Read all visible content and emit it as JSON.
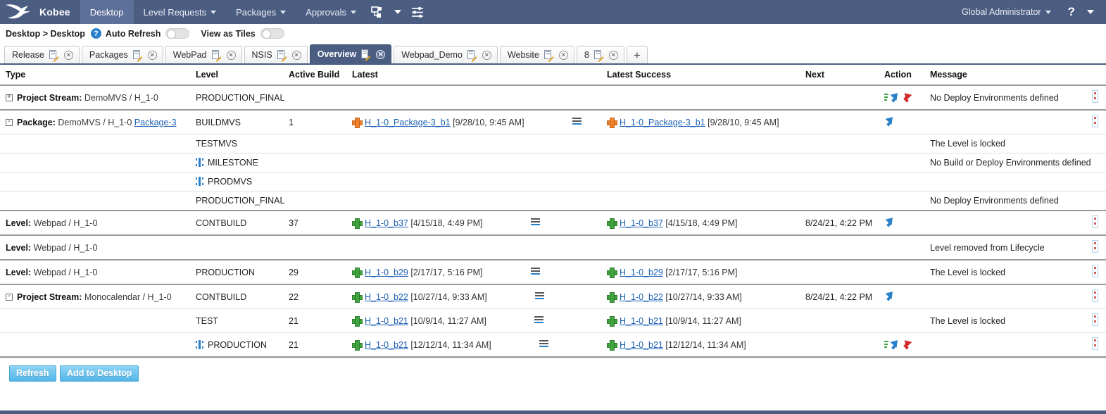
{
  "topnav": {
    "brand": "Kobee",
    "items": [
      {
        "label": "Desktop",
        "active": true,
        "caret": false
      },
      {
        "label": "Level Requests",
        "active": false,
        "caret": true
      },
      {
        "label": "Packages",
        "active": false,
        "caret": true
      },
      {
        "label": "Approvals",
        "active": false,
        "caret": true
      }
    ],
    "icons": [
      "workflow-icon",
      "chevron-down-icon",
      "sliders-icon"
    ],
    "user": "Global Administrator",
    "help": "?"
  },
  "crumb": {
    "text": "Desktop > Desktop",
    "help_label": "?",
    "auto_refresh_label": "Auto Refresh",
    "auto_refresh_on": false,
    "view_tiles_label": "View as Tiles",
    "view_tiles_on": false
  },
  "tabs": {
    "items": [
      {
        "label": "Release",
        "active": false
      },
      {
        "label": "Packages",
        "active": false
      },
      {
        "label": "WebPad",
        "active": false
      },
      {
        "label": "NSIS",
        "active": false
      },
      {
        "label": "Overview",
        "active": true
      },
      {
        "label": "Webpad_Demo",
        "active": false
      },
      {
        "label": "Website",
        "active": false
      },
      {
        "label": "8",
        "active": false
      }
    ],
    "add_label": "+"
  },
  "table": {
    "headers": [
      "Type",
      "Level",
      "Active Build",
      "Latest",
      "Latest Success",
      "Next",
      "Action",
      "Message"
    ],
    "rows": [
      {
        "group_top": true,
        "group_end": true,
        "expander": "+",
        "type_label": "Project Stream:",
        "type_value": "DemoMVS / H_1-0",
        "level": "PRODUCTION_FINAL",
        "level_milestone": false,
        "active_build": "",
        "latest_build": "",
        "latest_stamp": "",
        "latest_plus": "",
        "latest_list": false,
        "success_build": "",
        "success_stamp": "",
        "success_plus": "",
        "next": "",
        "action": "promote-rollback",
        "message": "No Deploy Environments defined",
        "edge": true
      },
      {
        "group_top": true,
        "expander": "-",
        "type_label": "Package:",
        "type_value": "DemoMVS / H_1-0",
        "type_link": "Package-3",
        "level": "BUILDMVS",
        "level_milestone": false,
        "active_build": "1",
        "latest_build": "H_1-0_Package-3_b1",
        "latest_stamp": "[9/28/10, 9:45 AM]",
        "latest_plus": "orange",
        "latest_list": true,
        "success_build": "H_1-0_Package-3_b1",
        "success_stamp": "[9/28/10, 9:45 AM]",
        "success_plus": "orange",
        "next": "",
        "action": "promote",
        "message": "",
        "edge": true
      },
      {
        "expander": "",
        "type_label": "",
        "type_value": "",
        "level": "TESTMVS",
        "level_milestone": false,
        "active_build": "",
        "latest_build": "",
        "latest_stamp": "",
        "latest_plus": "",
        "latest_list": false,
        "success_build": "",
        "success_stamp": "",
        "success_plus": "",
        "next": "",
        "action": "",
        "message": "The Level is locked",
        "edge": false
      },
      {
        "expander": "",
        "type_label": "",
        "type_value": "",
        "level": "MILESTONE",
        "level_milestone": true,
        "active_build": "",
        "latest_build": "",
        "latest_stamp": "",
        "latest_plus": "",
        "latest_list": false,
        "success_build": "",
        "success_stamp": "",
        "success_plus": "",
        "next": "",
        "action": "",
        "message": "No Build or Deploy Environments defined",
        "edge": false
      },
      {
        "expander": "",
        "type_label": "",
        "type_value": "",
        "level": "PRODMVS",
        "level_milestone": true,
        "active_build": "",
        "latest_build": "",
        "latest_stamp": "",
        "latest_plus": "",
        "latest_list": false,
        "success_build": "",
        "success_stamp": "",
        "success_plus": "",
        "next": "",
        "action": "",
        "message": "",
        "edge": false
      },
      {
        "group_end": true,
        "expander": "",
        "type_label": "",
        "type_value": "",
        "level": "PRODUCTION_FINAL",
        "level_milestone": false,
        "active_build": "",
        "latest_build": "",
        "latest_stamp": "",
        "latest_plus": "",
        "latest_list": false,
        "success_build": "",
        "success_stamp": "",
        "success_plus": "",
        "next": "",
        "action": "",
        "message": "No Deploy Environments defined",
        "edge": false
      },
      {
        "group_top": true,
        "group_end": true,
        "expander": "",
        "type_label": "Level:",
        "type_value": "Webpad / H_1-0",
        "level": "CONTBUILD",
        "level_milestone": false,
        "active_build": "37",
        "latest_build": "H_1-0_b37",
        "latest_stamp": "[4/15/18, 4:49 PM]",
        "latest_plus": "green",
        "latest_list": true,
        "success_build": "H_1-0_b37",
        "success_stamp": "[4/15/18, 4:49 PM]",
        "success_plus": "green",
        "next": "8/24/21, 4:22 PM",
        "action": "promote",
        "message": "",
        "edge": true
      },
      {
        "group_top": true,
        "group_end": true,
        "expander": "",
        "type_label": "Level:",
        "type_value": "Webpad / H_1-0",
        "level": "",
        "level_milestone": false,
        "active_build": "",
        "latest_build": "",
        "latest_stamp": "",
        "latest_plus": "",
        "latest_list": false,
        "success_build": "",
        "success_stamp": "",
        "success_plus": "",
        "next": "",
        "action": "",
        "message": "Level removed from Lifecycle",
        "edge": true
      },
      {
        "group_top": true,
        "group_end": true,
        "expander": "",
        "type_label": "Level:",
        "type_value": "Webpad / H_1-0",
        "level": "PRODUCTION",
        "level_milestone": false,
        "active_build": "29",
        "latest_build": "H_1-0_b29",
        "latest_stamp": "[2/17/17, 5:16 PM]",
        "latest_plus": "green",
        "latest_list": true,
        "success_build": "H_1-0_b29",
        "success_stamp": "[2/17/17, 5:16 PM]",
        "success_plus": "green",
        "next": "",
        "action": "",
        "message": "The Level is locked",
        "edge": true
      },
      {
        "group_top": true,
        "expander": "-",
        "type_label": "Project Stream:",
        "type_value": "Monocalendar / H_1-0",
        "level": "CONTBUILD",
        "level_milestone": false,
        "active_build": "22",
        "latest_build": "H_1-0_b22",
        "latest_stamp": "[10/27/14, 9:33 AM]",
        "latest_plus": "green",
        "latest_list": true,
        "success_build": "H_1-0_b22",
        "success_stamp": "[10/27/14, 9:33 AM]",
        "success_plus": "green",
        "next": "8/24/21, 4:22 PM",
        "action": "promote",
        "message": "",
        "edge": true
      },
      {
        "expander": "",
        "type_label": "",
        "type_value": "",
        "level": "TEST",
        "level_milestone": false,
        "active_build": "21",
        "latest_build": "H_1-0_b21",
        "latest_stamp": "[10/9/14, 11:27 AM]",
        "latest_plus": "green",
        "latest_list": true,
        "success_build": "H_1-0_b21",
        "success_stamp": "[10/9/14, 11:27 AM]",
        "success_plus": "green",
        "next": "",
        "action": "",
        "message": "The Level is locked",
        "edge": true
      },
      {
        "group_end": true,
        "expander": "",
        "type_label": "",
        "type_value": "",
        "level": "PRODUCTION",
        "level_milestone": true,
        "active_build": "21",
        "latest_build": "H_1-0_b21",
        "latest_stamp": "[12/12/14, 11:34 AM]",
        "latest_plus": "green",
        "latest_list": true,
        "success_build": "H_1-0_b21",
        "success_stamp": "[12/12/14, 11:34 AM]",
        "success_plus": "green",
        "next": "",
        "action": "promote-rollback",
        "message": "",
        "edge": true
      }
    ]
  },
  "footer": {
    "refresh_label": "Refresh",
    "add_label": "Add to Desktop"
  },
  "colors": {
    "nav_bg": "#4c5d82",
    "nav_active": "#5d7099",
    "link": "#1a5fb4",
    "button": "#53b6e8",
    "green": "#3fa33f",
    "orange": "#f0802a",
    "red": "#d22b2b",
    "blue": "#2a7fc9"
  }
}
